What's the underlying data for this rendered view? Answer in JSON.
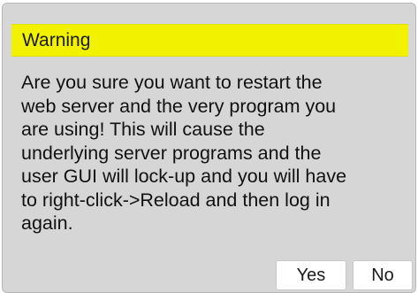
{
  "dialog": {
    "title": "Warning",
    "message": "Are you sure you want to restart the\nweb server and the very program you\nare using! This will cause the\nunderlying server programs and the\nuser GUI will lock-up and you will have\nto right-click->Reload and then log in\nagain.",
    "buttons": {
      "yes_label": "Yes",
      "no_label": "No"
    }
  },
  "colors": {
    "title_bar": "#f2f200",
    "dialog_background": "#d6d6d6",
    "button_background": "#ffffff"
  }
}
